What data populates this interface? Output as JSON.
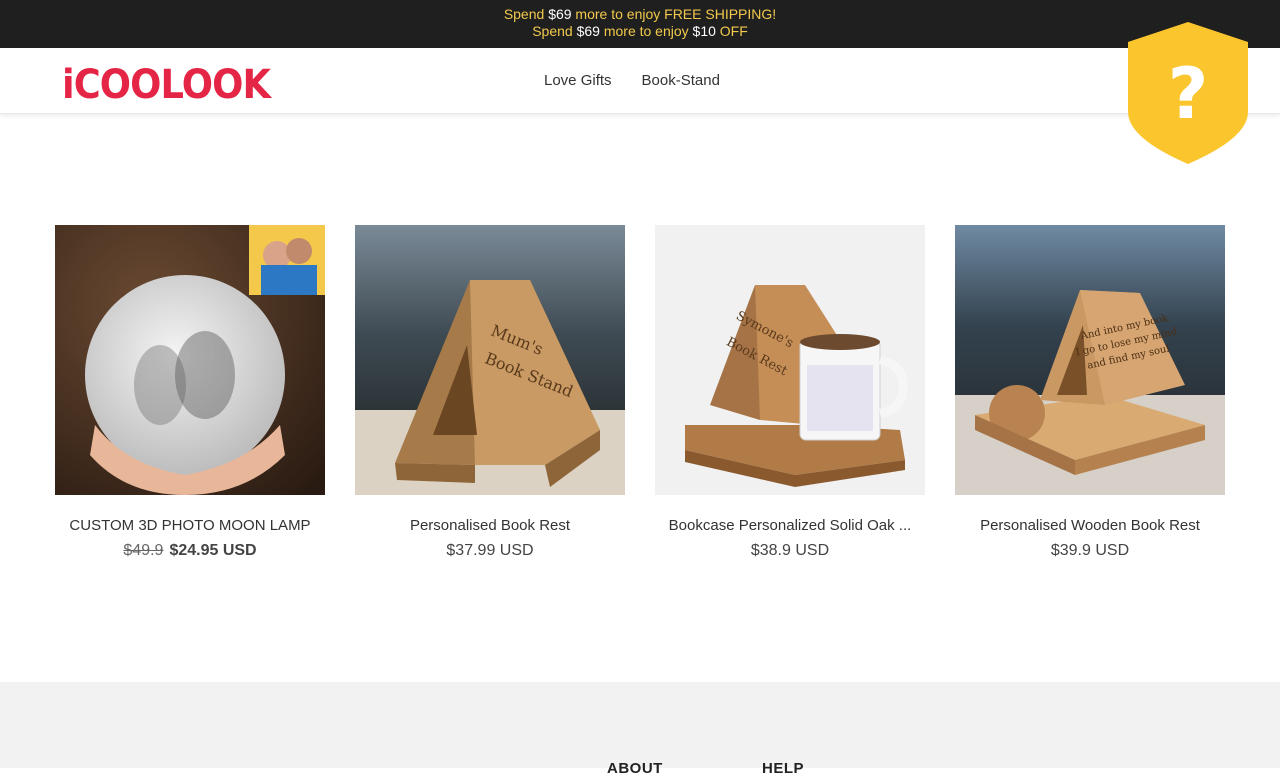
{
  "announcement": {
    "line1_prefix": "Spend ",
    "line1_amount": "$69",
    "line1_suffix": " more to enjoy FREE SHIPPING!",
    "line2_prefix": "Spend ",
    "line2_amount": "$69",
    "line2_mid": " more to enjoy ",
    "line2_discount": "$10",
    "line2_suffix": " OFF"
  },
  "header": {
    "logo_text": "iCOOLOOK",
    "nav": [
      {
        "label": "Love Gifts"
      },
      {
        "label": "Book-Stand"
      }
    ]
  },
  "badge": {
    "icon": "question-shield-icon",
    "color": "#fbc52e"
  },
  "products": [
    {
      "name": "CUSTOM 3D PHOTO MOON LAMP",
      "old_price": "$49.9",
      "price": "$24.95 USD"
    },
    {
      "name": "Personalised Book Rest",
      "price": "$37.99 USD",
      "engraving": [
        "Mum's",
        "Book Stand"
      ]
    },
    {
      "name": "Bookcase Personalized Solid Oak ...",
      "price": "$38.9 USD",
      "engraving": [
        "Symone's",
        "Book Rest"
      ]
    },
    {
      "name": "Personalised Wooden Book Rest",
      "price": "$39.9 USD",
      "engraving": [
        "And into my book",
        "I go to lose my mind",
        "and find my soul"
      ]
    }
  ],
  "footer": {
    "col1": "ABOUT",
    "col2": "HELP"
  },
  "colors": {
    "announcement_bg": "#1f1f1f",
    "announcement_text": "#f2c94c",
    "brand": "#e52545",
    "footer_bg": "#f2f2f2"
  }
}
